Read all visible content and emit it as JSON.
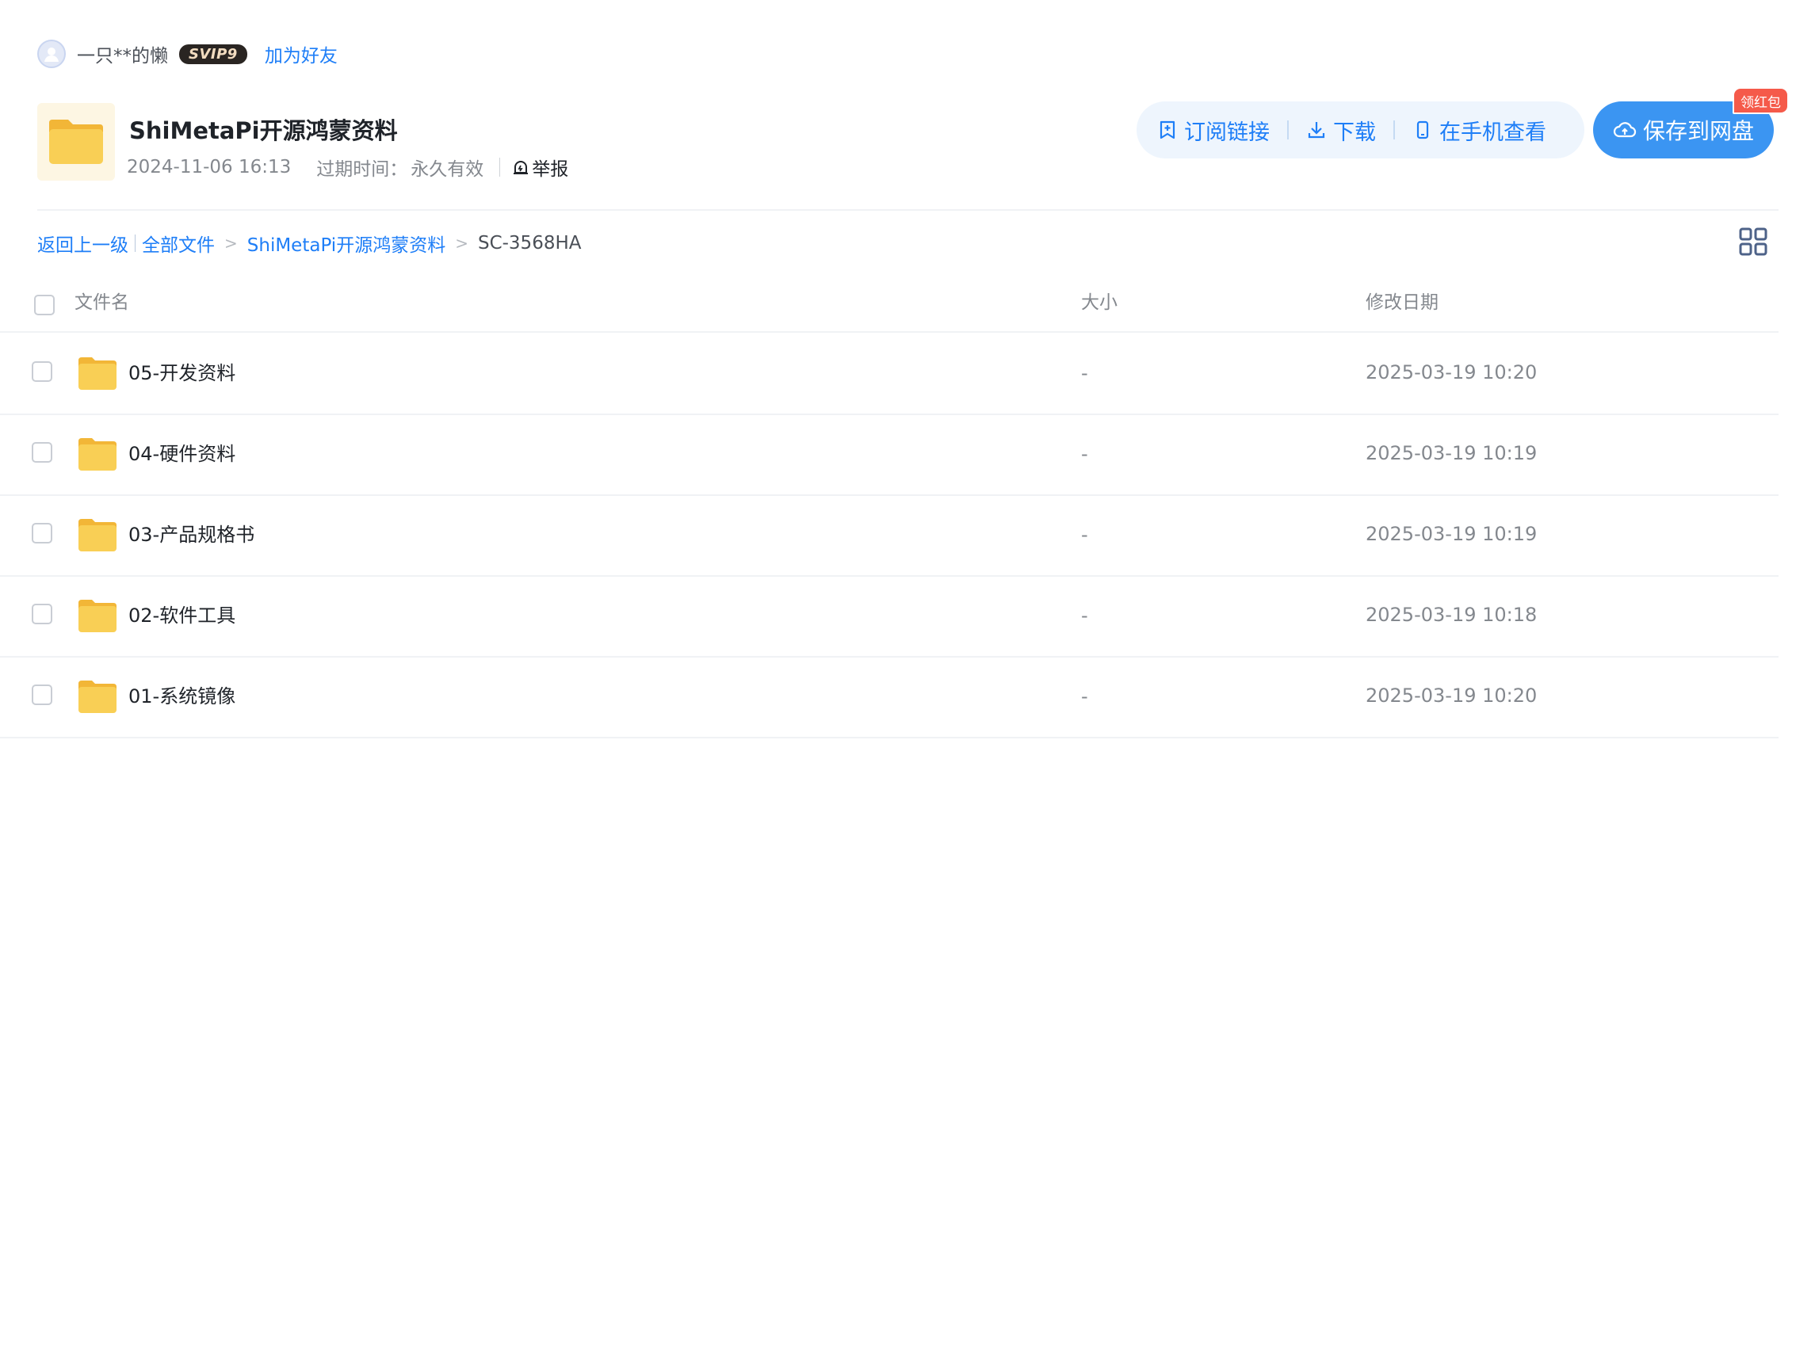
{
  "user": {
    "name": "一只**的懒",
    "vip": "SVIP9",
    "add_friend": "加为好友"
  },
  "share": {
    "title": "ShiMetaPi开源鸿蒙资料",
    "date": "2024-11-06 16:13",
    "expire_label": "过期时间：",
    "expire_value": "永久有效",
    "report": "举报"
  },
  "actions": {
    "subscribe": "订阅链接",
    "download": "下载",
    "phone_view": "在手机查看",
    "save": "保存到网盘",
    "red_packet": "领红包"
  },
  "breadcrumb": {
    "back": "返回上一级",
    "all_files": "全部文件",
    "parent": "ShiMetaPi开源鸿蒙资料",
    "current": "SC-3568HA",
    "separator": ">"
  },
  "table": {
    "headers": {
      "name": "文件名",
      "size": "大小",
      "mtime": "修改日期"
    },
    "rows": [
      {
        "name": "05-开发资料",
        "size": "-",
        "mtime": "2025-03-19 10:20"
      },
      {
        "name": "04-硬件资料",
        "size": "-",
        "mtime": "2025-03-19 10:19"
      },
      {
        "name": "03-产品规格书",
        "size": "-",
        "mtime": "2025-03-19 10:19"
      },
      {
        "name": "02-软件工具",
        "size": "-",
        "mtime": "2025-03-19 10:18"
      },
      {
        "name": "01-系统镜像",
        "size": "-",
        "mtime": "2025-03-19 10:20"
      }
    ]
  },
  "colors": {
    "accent": "#1e7ef7",
    "save_button": "#3b95f2",
    "red_tag": "#f55a4a",
    "folder": "#f7c948"
  }
}
